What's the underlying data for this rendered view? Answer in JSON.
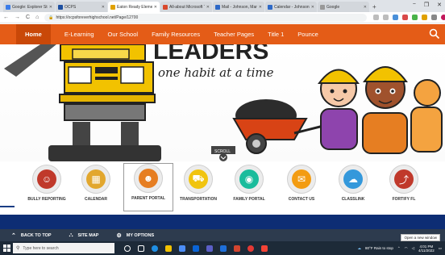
{
  "browser": {
    "tabs": [
      {
        "title": "Google: Explorer Students",
        "favicon_color": "#3b7de9",
        "active": false
      },
      {
        "title": "OCPS",
        "favicon_color": "#1d4fa0",
        "active": false
      },
      {
        "title": "Eaton Ready Elementary",
        "favicon_color": "#e0a100",
        "active": true
      },
      {
        "title": "All-about Microsoft Teams",
        "favicon_color": "#d9482b",
        "active": false
      },
      {
        "title": "Mail - Johnson, Mark",
        "favicon_color": "#2e69c7",
        "active": false
      },
      {
        "title": "Calendar - Johnson, Mark",
        "favicon_color": "#2e69c7",
        "active": false
      },
      {
        "title": "Google",
        "favicon_color": "#999999",
        "active": false
      }
    ],
    "new_tab_glyph": "+",
    "url": "https://ocpsforeverhighschool.net/Page/12700",
    "window_controls": [
      "−",
      "❐",
      "✕"
    ],
    "nav_glyphs": {
      "back": "←",
      "forward": "→",
      "reload": "C",
      "home": "⌂"
    }
  },
  "site_nav": {
    "items": [
      "Home",
      "E-Learning",
      "Our School",
      "Family Resources",
      "Teacher Pages",
      "Title 1",
      "Pounce"
    ],
    "accent": "#e45c17"
  },
  "banner": {
    "headline": "LEADERS",
    "tagline": "one habit at a time",
    "scroll_label": "SCROLL"
  },
  "quick_links": [
    {
      "label": "BULLY REPORTING",
      "icon": "bully-reporting-icon",
      "color": "#c0392b"
    },
    {
      "label": "CALENDAR",
      "icon": "calendar-icon",
      "color": "#e2a72e"
    },
    {
      "label": "PARENT PORTAL",
      "icon": "parent-portal-icon",
      "color": "#e67e22",
      "selected": true
    },
    {
      "label": "TRANSPORTATION",
      "icon": "bus-icon",
      "color": "#f1c40f"
    },
    {
      "label": "FAMILY PORTAL",
      "icon": "family-portal-icon",
      "color": "#1abc9c"
    },
    {
      "label": "CONTACT US",
      "icon": "envelope-icon",
      "color": "#f39c12"
    },
    {
      "label": "CLASSLINK",
      "icon": "classlink-cloud-icon",
      "color": "#3498db"
    },
    {
      "label": "FORTIFY FL",
      "icon": "fortify-icon",
      "color": "#c0392b"
    }
  ],
  "site_bar": {
    "items": [
      {
        "label": "BACK TO TOP",
        "icon": "chevron-up-icon"
      },
      {
        "label": "SITE MAP",
        "icon": "sitemap-icon"
      },
      {
        "label": "MY OPTIONS",
        "icon": "gear-icon"
      }
    ],
    "tooltip": "Open a new window"
  },
  "taskbar": {
    "search_placeholder": "Type here to search",
    "weather": "80°F  Rain to stop",
    "time": "4:01 PM",
    "date": "4/11/2022"
  }
}
